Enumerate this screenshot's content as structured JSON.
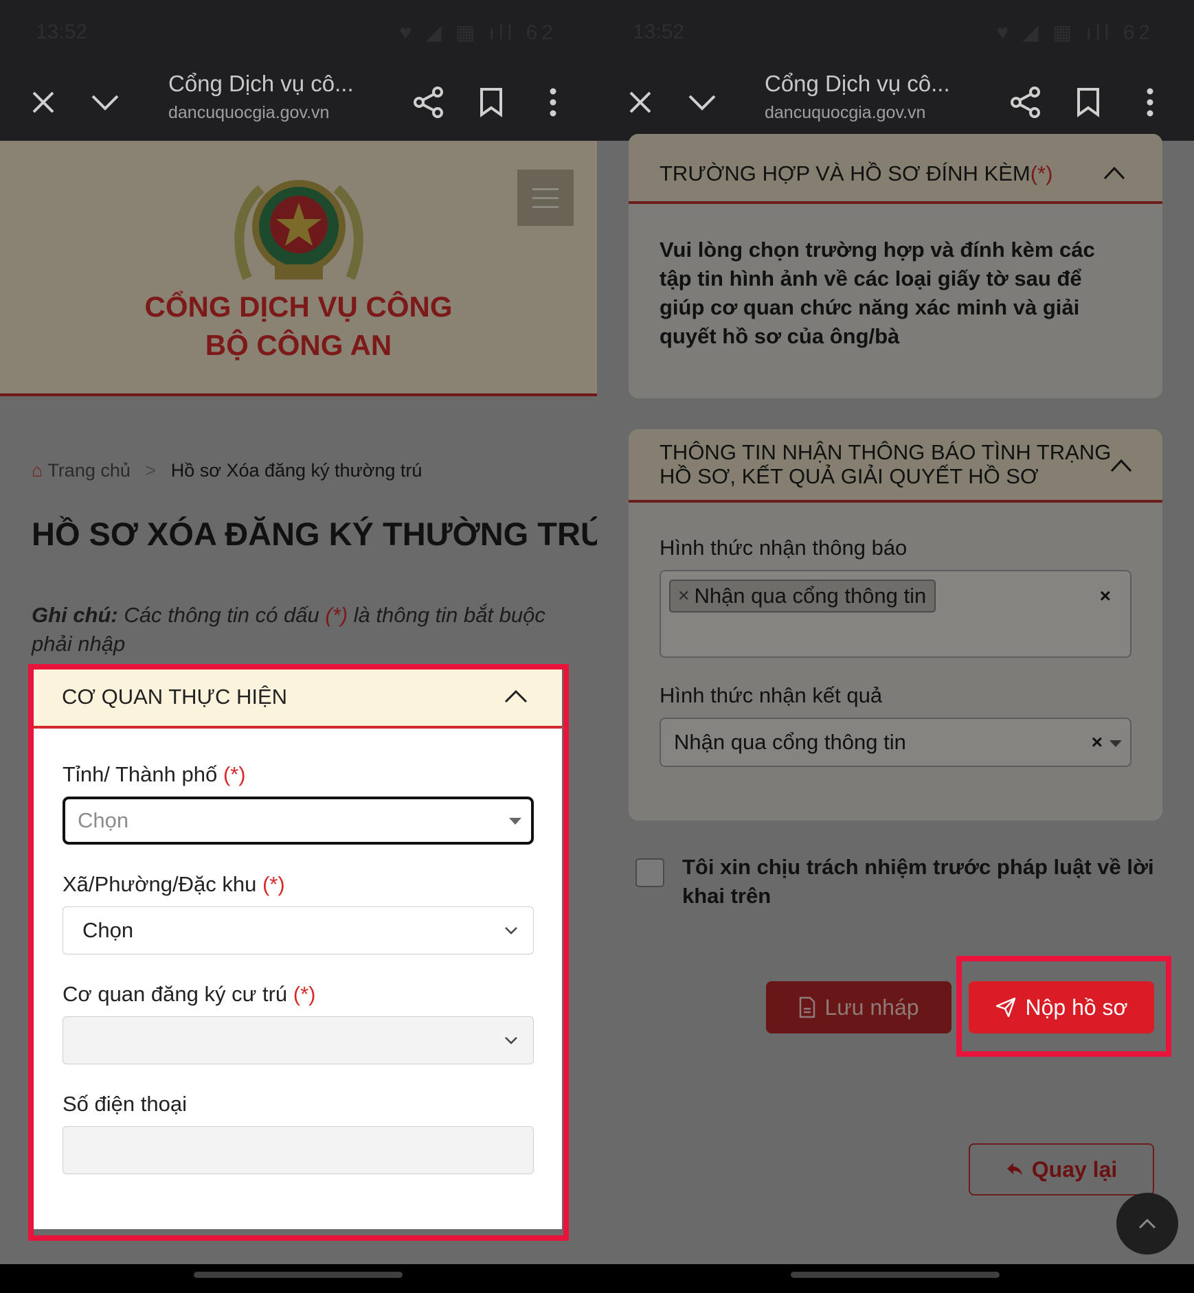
{
  "left": {
    "status": {
      "time": "13:52",
      "icons": "♥ ◢ ▦ ıll",
      "battery": "62"
    },
    "browser": {
      "title": "Cổng Dịch vụ cô...",
      "url": "dancuquocgia.gov.vn"
    },
    "banner": {
      "line1": "CỔNG DỊCH VỤ CÔNG",
      "line2": "BỘ CÔNG AN"
    },
    "breadcrumb": {
      "home": "Trang chủ",
      "separator": ">",
      "current": "Hồ sơ Xóa đăng ký thường trú"
    },
    "page_title": "HỒ SƠ XÓA ĐĂNG KÝ THƯỜNG TRÚ",
    "note": {
      "label": "Ghi chú:",
      "text1": "Các thông tin có dấu",
      "mark": "(*)",
      "text2": "là thông tin bắt buộc phải nhập"
    },
    "section": {
      "title": "CƠ QUAN THỰC HIỆN",
      "required_mark": "(*)",
      "province": {
        "label": "Tỉnh/ Thành phố",
        "placeholder": "Chọn"
      },
      "ward": {
        "label": "Xã/Phường/Đặc khu",
        "value": "Chọn"
      },
      "agency": {
        "label": "Cơ quan đăng ký cư trú",
        "value": ""
      },
      "phone": {
        "label": "Số điện thoại",
        "value": ""
      }
    }
  },
  "right": {
    "status": {
      "time": "13:52",
      "icons": "♥ ◢ ▦ ıll",
      "battery": "62"
    },
    "browser": {
      "title": "Cổng Dịch vụ cô...",
      "url": "dancuquocgia.gov.vn"
    },
    "attach_section": {
      "title": "TRƯỜNG HỢP VÀ HỒ SƠ ĐÍNH KÈM",
      "required_mark": "(*)",
      "body": "Vui lòng chọn trường hợp và đính kèm các tập tin hình ảnh về các loại giấy tờ sau để giúp cơ quan chức năng xác minh và giải quyết hồ sơ của ông/bà"
    },
    "notify_section": {
      "title_line1": "THÔNG TIN NHẬN THÔNG BÁO TÌNH TRẠNG",
      "title_line2": "HỒ SƠ, KẾT QUẢ GIẢI QUYẾT HỒ SƠ",
      "notify_method": {
        "label": "Hình thức nhận thông báo",
        "tag": "Nhận qua cổng thông tin",
        "clear": "×"
      },
      "result_method": {
        "label": "Hình thức nhận kết quả",
        "value": "Nhận qua cổng thông tin",
        "clear": "×"
      }
    },
    "declaration": "Tôi xin chịu trách nhiệm trước pháp luật về lời khai trên",
    "buttons": {
      "draft": "Lưu nháp",
      "submit": "Nộp hồ sơ",
      "back": "Quay lại"
    }
  },
  "colors": {
    "accent_red": "#d91c26",
    "highlight": "#e8143c",
    "banner_text": "#7c1a1a"
  }
}
